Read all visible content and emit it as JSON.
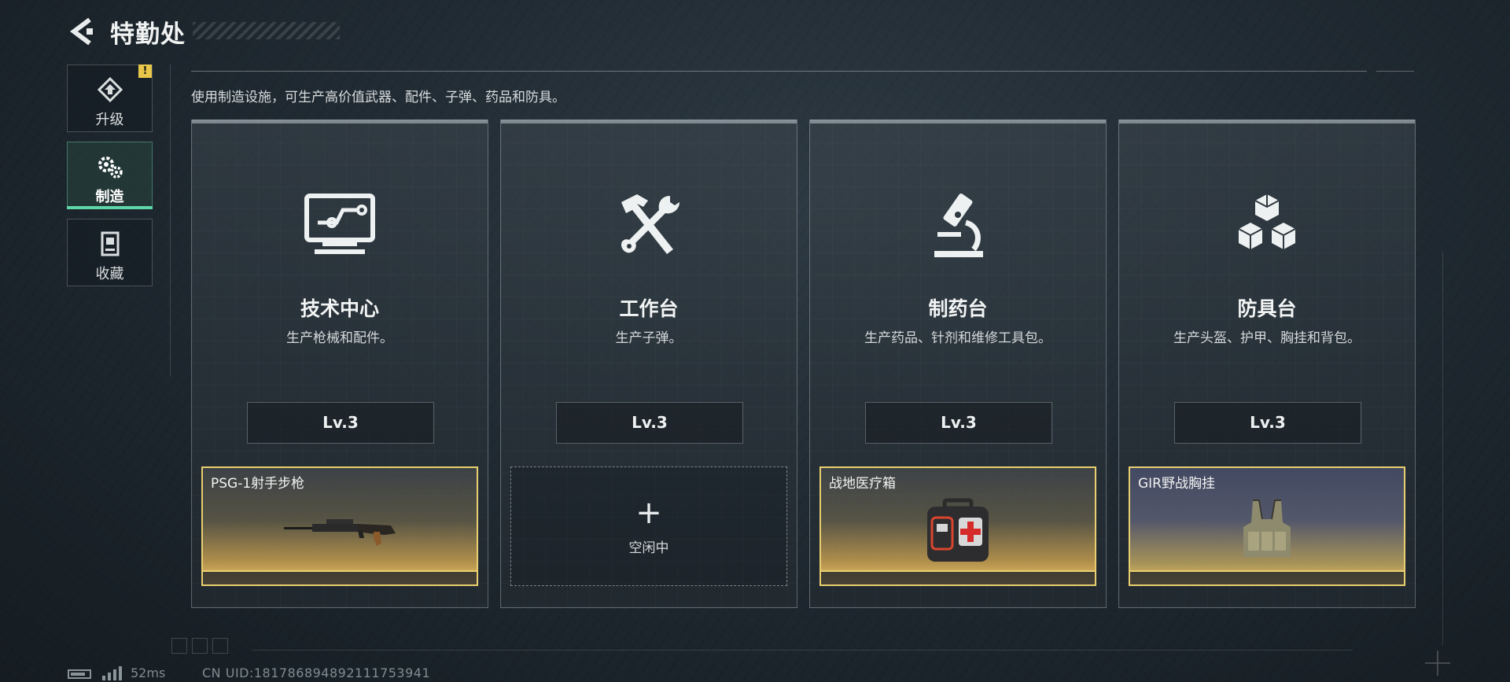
{
  "header": {
    "title": "特勤处"
  },
  "sidebar": {
    "items": [
      {
        "label": "升级",
        "icon": "upgrade-icon",
        "alert": "!"
      },
      {
        "label": "制造",
        "icon": "gears-icon"
      },
      {
        "label": "收藏",
        "icon": "collection-icon"
      }
    ],
    "active": "制造"
  },
  "intro": "使用制造设施，可生产高价值武器、配件、子弹、药品和防具。",
  "cards": [
    {
      "name": "技术中心",
      "desc": "生产枪械和配件。",
      "level": "Lv.3",
      "icon": "monitor-circuit-icon",
      "slot": {
        "state": "busy",
        "item": "PSG-1射手步枪",
        "image": "rifle-icon",
        "style": "gold"
      }
    },
    {
      "name": "工作台",
      "desc": "生产子弹。",
      "level": "Lv.3",
      "icon": "hammer-wrench-icon",
      "slot": {
        "state": "idle",
        "symbol": "+",
        "label": "空闲中"
      }
    },
    {
      "name": "制药台",
      "desc": "生产药品、针剂和维修工具包。",
      "level": "Lv.3",
      "icon": "microscope-icon",
      "slot": {
        "state": "busy",
        "item": "战地医疗箱",
        "image": "medkit-icon",
        "style": "gold"
      }
    },
    {
      "name": "防具台",
      "desc": "生产头盔、护甲、胸挂和背包。",
      "level": "Lv.3",
      "icon": "cubes-icon",
      "slot": {
        "state": "busy",
        "item": "GIR野战胸挂",
        "image": "chest-rig-icon",
        "style": "blue"
      }
    }
  ],
  "status": {
    "ping": "52ms",
    "uid": "CN UID:18178689489211175394​1"
  },
  "colors": {
    "accent": "#5fd6a8",
    "gold": "#e9cf6f",
    "alert": "#e8c64a"
  }
}
